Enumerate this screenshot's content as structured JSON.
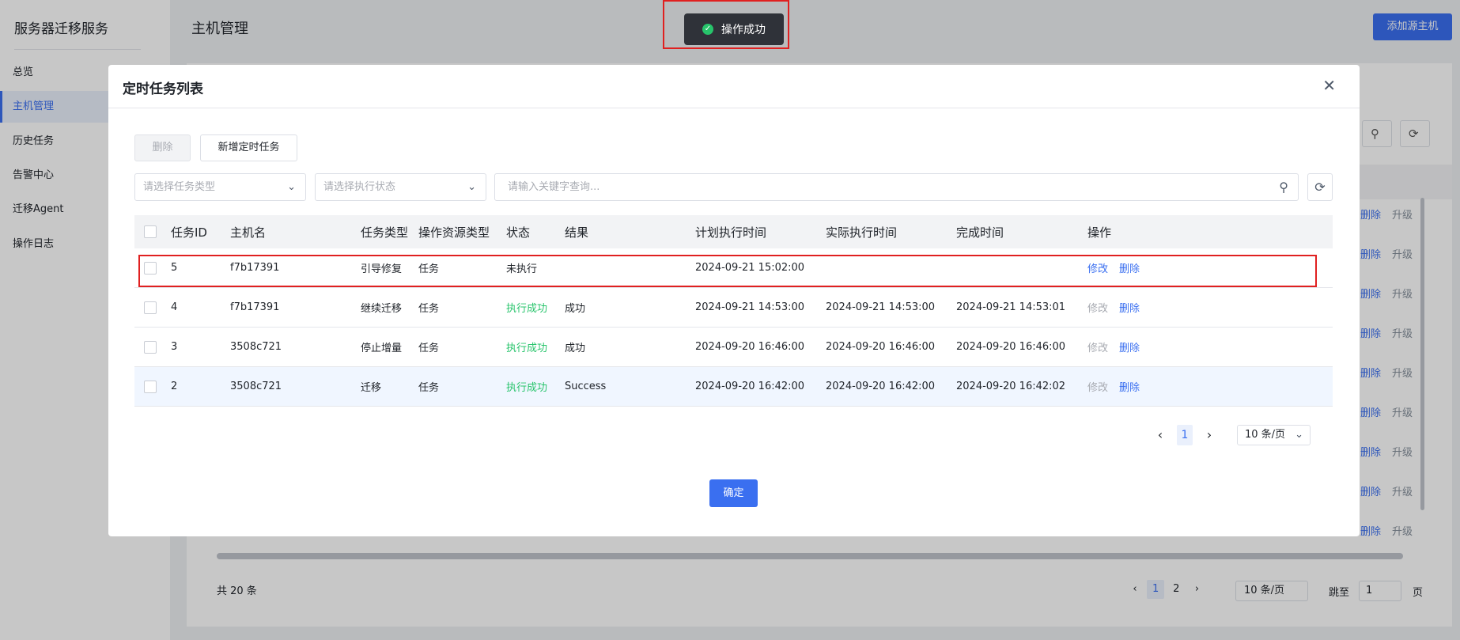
{
  "app": {
    "brand": "服务器迁移服务",
    "nav": [
      "总览",
      "主机管理",
      "历史任务",
      "告警中心",
      "迁移Agent",
      "操作日志"
    ],
    "active_nav": "主机管理",
    "page_title": "主机管理",
    "add_source_host_label": "添加源主机",
    "bg_row_actions": {
      "delete": "删除",
      "upgrade": "升级"
    },
    "bg_total": "共 20 条",
    "bg_pages": [
      "1",
      "2"
    ],
    "bg_page_size": "10 条/页",
    "bg_jump_label": "跳至",
    "bg_jump_value": "1",
    "bg_page_unit": "页"
  },
  "toast": {
    "text": "操作成功",
    "icon": "check-circle-icon",
    "color": "#27c46b"
  },
  "modal": {
    "title": "定时任务列表",
    "delete_label": "删除",
    "add_task_label": "新增定时任务",
    "task_type_placeholder": "请选择任务类型",
    "exec_status_placeholder": "请选择执行状态",
    "search_placeholder": "请输入关键字查询...",
    "columns": [
      "任务ID",
      "主机名",
      "任务类型",
      "操作资源类型",
      "状态",
      "结果",
      "计划执行时间",
      "实际执行时间",
      "完成时间",
      "操作"
    ],
    "rows": [
      {
        "id": "5",
        "host": "f7b17391",
        "task_type": "引导修复",
        "resource_type": "任务",
        "status": "未执行",
        "result": "",
        "planned": "2024-09-21 15:02:00",
        "actual": "",
        "finished": "",
        "edit": "修改",
        "delete": "删除"
      },
      {
        "id": "4",
        "host": "f7b17391",
        "task_type": "继续迁移",
        "resource_type": "任务",
        "status": "执行成功",
        "result": "成功",
        "planned": "2024-09-21 14:53:00",
        "actual": "2024-09-21 14:53:00",
        "finished": "2024-09-21 14:53:01",
        "edit": "修改",
        "delete": "删除"
      },
      {
        "id": "3",
        "host": "3508c721",
        "task_type": "停止增量",
        "resource_type": "任务",
        "status": "执行成功",
        "result": "成功",
        "planned": "2024-09-20 16:46:00",
        "actual": "2024-09-20 16:46:00",
        "finished": "2024-09-20 16:46:00",
        "edit": "修改",
        "delete": "删除"
      },
      {
        "id": "2",
        "host": "3508c721",
        "task_type": "迁移",
        "resource_type": "任务",
        "status": "执行成功",
        "result": "Success",
        "planned": "2024-09-20 16:42:00",
        "actual": "2024-09-20 16:42:00",
        "finished": "2024-09-20 16:42:02",
        "edit": "修改",
        "delete": "删除"
      }
    ],
    "current_page": "1",
    "page_size": "10 条/页",
    "confirm_label": "确定"
  },
  "colors": {
    "primary": "#3a6ff0",
    "success": "#27c46b",
    "highlight": "#e02020"
  }
}
